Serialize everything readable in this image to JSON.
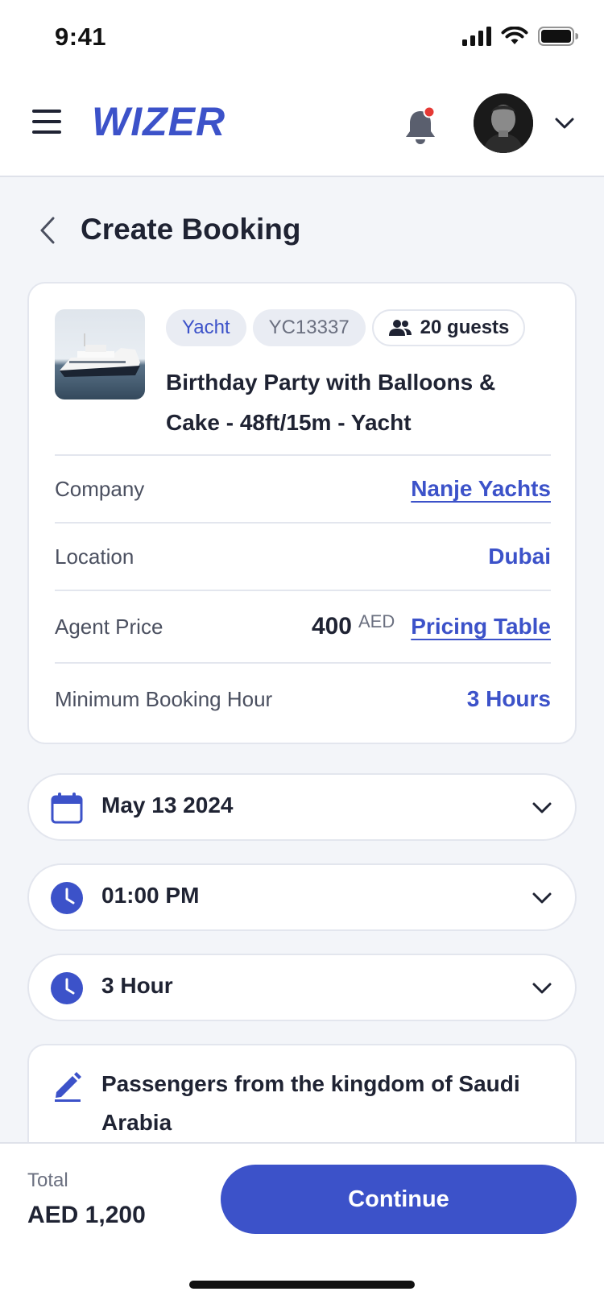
{
  "status_bar": {
    "time": "9:41"
  },
  "app_bar": {
    "logo": "WIZER",
    "notification_dot_color": "#e53935"
  },
  "page": {
    "title": "Create Booking"
  },
  "listing": {
    "type_chip": "Yacht",
    "code_chip": "YC13337",
    "guests_chip": "20 guests",
    "title": "Birthday Party with Balloons & Cake - 48ft/15m - Yacht",
    "company_label": "Company",
    "company_value": "Nanje Yachts",
    "location_label": "Location",
    "location_value": "Dubai",
    "price_label": "Agent Price",
    "price_value": "400",
    "price_currency": "AED",
    "pricing_table_link": "Pricing Table",
    "min_hours_label": "Minimum Booking Hour",
    "min_hours_value": "3 Hours"
  },
  "booking": {
    "date": "May 13 2024",
    "time": "01:00 PM",
    "duration": "3 Hour",
    "note": "Passengers from the kingdom of Saudi Arabia"
  },
  "footer": {
    "total_label": "Total",
    "total_value": "AED 1,200",
    "continue_label": "Continue"
  },
  "colors": {
    "accent": "#3c52c9",
    "background": "#f3f5f9",
    "text": "#1f2333"
  },
  "icons": [
    "menu-icon",
    "bell-icon",
    "chevron-down-icon",
    "back-icon",
    "users-icon",
    "calendar-icon",
    "clock-icon",
    "pencil-icon"
  ]
}
